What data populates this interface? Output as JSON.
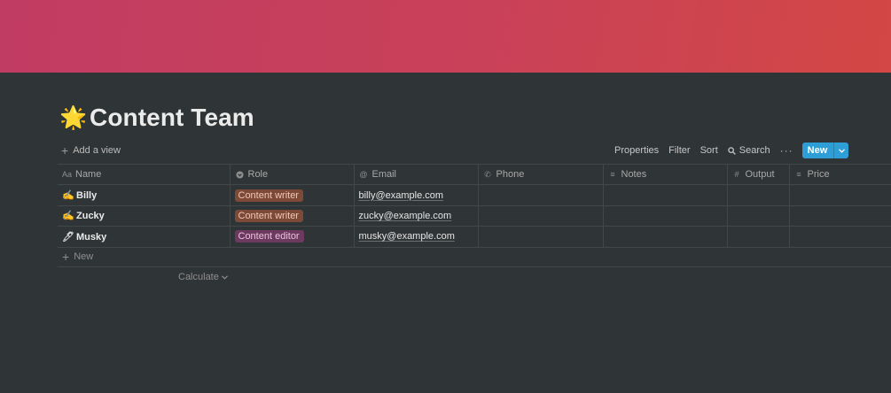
{
  "cover": {
    "colors": [
      "#c13c63",
      "#d34745"
    ]
  },
  "page": {
    "emoji": "🌟",
    "icon": "glowing-star-icon",
    "title": "Content Team"
  },
  "view_bar": {
    "add_view_label": "Add a view",
    "toolbar": {
      "properties": "Properties",
      "filter": "Filter",
      "sort": "Sort",
      "search": "Search",
      "more": "···",
      "new": "New"
    }
  },
  "table": {
    "columns": [
      {
        "label": "Name",
        "icon": "text-icon",
        "glyph": "Aa"
      },
      {
        "label": "Role",
        "icon": "select-icon",
        "glyph": "▾"
      },
      {
        "label": "Email",
        "icon": "at-icon",
        "glyph": "@"
      },
      {
        "label": "Phone",
        "icon": "phone-icon",
        "glyph": "✆"
      },
      {
        "label": "Notes",
        "icon": "lines-icon",
        "glyph": "≡"
      },
      {
        "label": "Output",
        "icon": "hash-icon",
        "glyph": "#"
      },
      {
        "label": "Price",
        "icon": "lines-icon",
        "glyph": "≡"
      }
    ],
    "rows": [
      {
        "emoji": "✍",
        "name": "Billy",
        "role": "Content writer",
        "role_color": "#7d4a37",
        "email": "billy@example.com",
        "phone": "",
        "notes": "",
        "output": "",
        "price": ""
      },
      {
        "emoji": "✍",
        "name": "Zucky",
        "role": "Content writer",
        "role_color": "#7d4a37",
        "email": "zucky@example.com",
        "phone": "",
        "notes": "",
        "output": "",
        "price": ""
      },
      {
        "emoji": "🖊",
        "name": "Musky",
        "role": "Content editor",
        "role_color": "#6b3a5e",
        "email": "musky@example.com",
        "phone": "",
        "notes": "",
        "output": "",
        "price": ""
      }
    ],
    "new_row_label": "New",
    "calculate_label": "Calculate"
  },
  "colors": {
    "background": "#2f3437",
    "accent": "#2e9fd6"
  }
}
